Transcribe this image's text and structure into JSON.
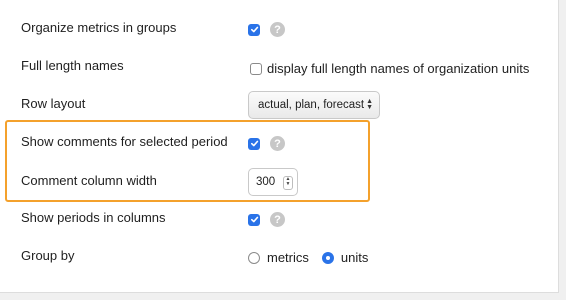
{
  "settings": {
    "organize_groups": {
      "label": "Organize metrics in groups",
      "checked": true,
      "help": "?"
    },
    "full_length_names": {
      "label": "Full length names",
      "checked": false,
      "option_text": "display full length names of organization units"
    },
    "row_layout": {
      "label": "Row layout",
      "value": "actual, plan, forecast"
    },
    "show_comments": {
      "label": "Show comments for selected period",
      "checked": true,
      "help": "?"
    },
    "comment_width": {
      "label": "Comment column width",
      "value": "300"
    },
    "periods_in_columns": {
      "label": "Show periods in columns",
      "checked": true,
      "help": "?"
    },
    "group_by": {
      "label": "Group by",
      "options": [
        {
          "label": "metrics",
          "selected": false
        },
        {
          "label": "units",
          "selected": true
        }
      ]
    }
  },
  "colors": {
    "accent": "#2a73e8",
    "highlight": "#f4a12c",
    "help_icon": "#c7c7c7"
  }
}
